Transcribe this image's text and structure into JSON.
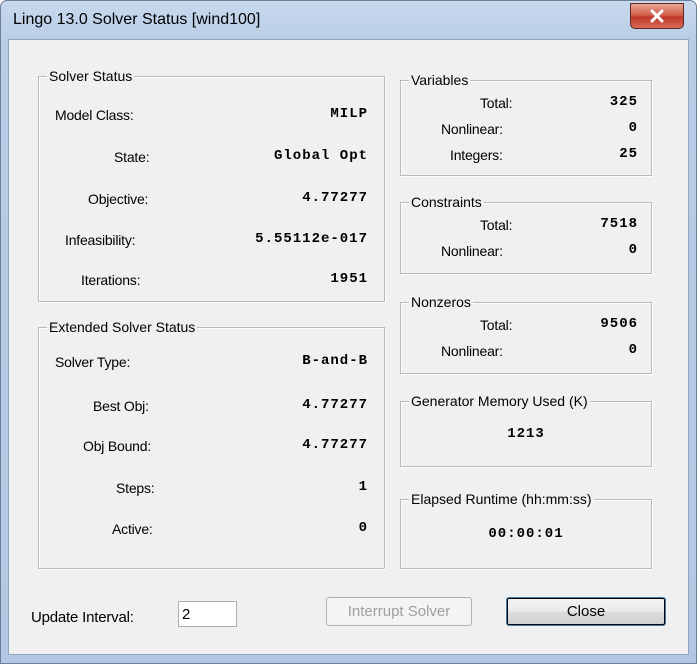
{
  "window": {
    "title": "Lingo 13.0 Solver Status [wind100]"
  },
  "solver_status": {
    "legend": "Solver Status",
    "model_class": {
      "label": "Model Class:",
      "value": "MILP"
    },
    "state": {
      "label": "State:",
      "value": "Global Opt"
    },
    "objective": {
      "label": "Objective:",
      "value": "4.77277"
    },
    "infeasibility": {
      "label": "Infeasibility:",
      "value": "5.55112e-017"
    },
    "iterations": {
      "label": "Iterations:",
      "value": "1951"
    }
  },
  "extended_status": {
    "legend": "Extended Solver Status",
    "solver_type": {
      "label": "Solver Type:",
      "value": "B-and-B"
    },
    "best_obj": {
      "label": "Best Obj:",
      "value": "4.77277"
    },
    "obj_bound": {
      "label": "Obj Bound:",
      "value": "4.77277"
    },
    "steps": {
      "label": "Steps:",
      "value": "1"
    },
    "active": {
      "label": "Active:",
      "value": "0"
    }
  },
  "variables": {
    "legend": "Variables",
    "total": {
      "label": "Total:",
      "value": "325"
    },
    "nonlinear": {
      "label": "Nonlinear:",
      "value": "0"
    },
    "integers": {
      "label": "Integers:",
      "value": "25"
    }
  },
  "constraints": {
    "legend": "Constraints",
    "total": {
      "label": "Total:",
      "value": "7518"
    },
    "nonlinear": {
      "label": "Nonlinear:",
      "value": "0"
    }
  },
  "nonzeros": {
    "legend": "Nonzeros",
    "total": {
      "label": "Total:",
      "value": "9506"
    },
    "nonlinear": {
      "label": "Nonlinear:",
      "value": "0"
    }
  },
  "generator_memory": {
    "legend": "Generator Memory Used (K)",
    "value": "1213"
  },
  "elapsed_runtime": {
    "legend": "Elapsed Runtime (hh:mm:ss)",
    "value": "00:00:01"
  },
  "update_interval": {
    "label": "Update Interval:",
    "value": "2"
  },
  "buttons": {
    "interrupt": "Interrupt Solver",
    "close": "Close"
  },
  "icons": {
    "close": "close-x-icon"
  },
  "colors": {
    "close_button": "#c0392b",
    "title_bar": "#c9d9ee",
    "dialog_face": "#f0f0f0"
  }
}
